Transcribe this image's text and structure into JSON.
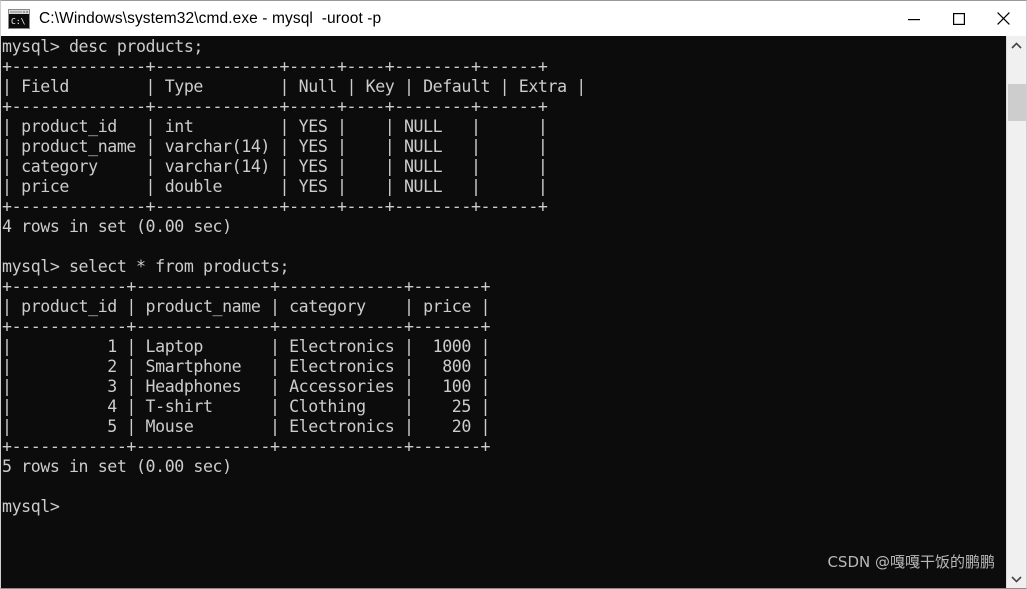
{
  "window": {
    "title": "C:\\Windows\\system32\\cmd.exe - mysql  -uroot -p",
    "icon": "cmd-icon",
    "background_color": "#0c0c0c",
    "titlebar_color": "#ffffff",
    "text_color": "#cccccc",
    "controls": [
      {
        "name": "minimize",
        "glyph": "minimize-icon"
      },
      {
        "name": "maximize",
        "glyph": "maximize-icon"
      },
      {
        "name": "close",
        "glyph": "close-icon"
      }
    ]
  },
  "scrollbar": {
    "up_arrow": "chevron-up-icon",
    "down_arrow": "chevron-down-icon",
    "track_color": "#f0f0f0",
    "thumb_color": "#cdcdcd"
  },
  "watermark": {
    "text": "CSDN @嘎嘎干饭的鹏鹏"
  },
  "session": {
    "prompt": "mysql>",
    "commands": [
      {
        "prompt": "mysql>",
        "text": "desc products;"
      },
      {
        "prompt": "mysql>",
        "text": "select * from products;"
      }
    ],
    "results": [
      {
        "summary": "4 rows in set (0.00 sec)"
      },
      {
        "summary": "5 rows in set (0.00 sec)"
      }
    ]
  },
  "desc_table": {
    "columns": [
      "Field",
      "Type",
      "Null",
      "Key",
      "Default",
      "Extra"
    ],
    "widths": [
      14,
      13,
      5,
      4,
      8,
      6
    ],
    "rows": [
      [
        "product_id",
        "int",
        "YES",
        "",
        "NULL",
        ""
      ],
      [
        "product_name",
        "varchar(14)",
        "YES",
        "",
        "NULL",
        ""
      ],
      [
        "category",
        "varchar(14)",
        "YES",
        "",
        "NULL",
        ""
      ],
      [
        "price",
        "double",
        "YES",
        "",
        "NULL",
        ""
      ]
    ],
    "row_count": 4,
    "duration": "0.00 sec"
  },
  "select_table": {
    "columns": [
      "product_id",
      "product_name",
      "category",
      "price"
    ],
    "widths": [
      12,
      14,
      13,
      7
    ],
    "align": [
      "right",
      "left",
      "left",
      "right"
    ],
    "rows": [
      [
        "1",
        "Laptop",
        "Electronics",
        "1000"
      ],
      [
        "2",
        "Smartphone",
        "Electronics",
        "800"
      ],
      [
        "3",
        "Headphones",
        "Accessories",
        "100"
      ],
      [
        "4",
        "T-shirt",
        "Clothing",
        "25"
      ],
      [
        "5",
        "Mouse",
        "Electronics",
        "20"
      ]
    ],
    "row_count": 5,
    "duration": "0.00 sec"
  },
  "console_text": ""
}
